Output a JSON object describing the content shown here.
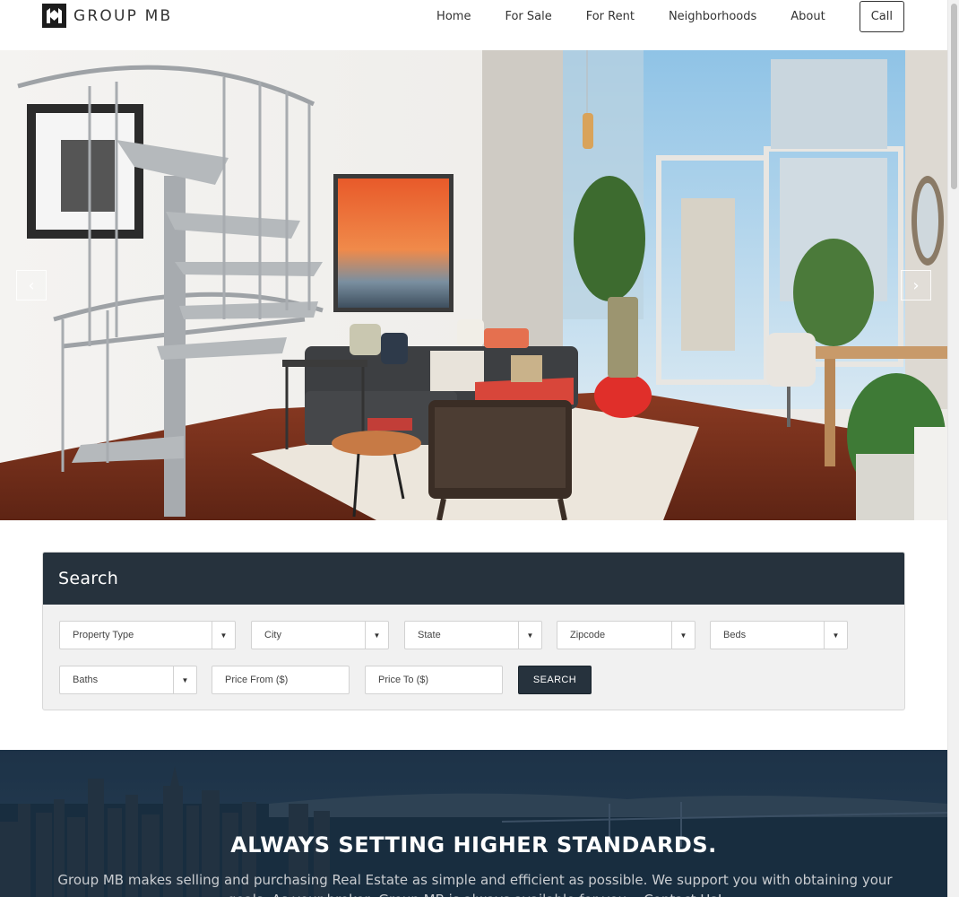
{
  "brand": {
    "name": "GROUP MB"
  },
  "nav": {
    "items": [
      "Home",
      "For Sale",
      "For Rent",
      "Neighborhoods",
      "About"
    ],
    "call_label": "Call"
  },
  "hero": {
    "prev_icon": "chevron-left-icon",
    "next_icon": "chevron-right-icon",
    "prev_glyph": "‹",
    "next_glyph": "›"
  },
  "search": {
    "title": "Search",
    "selects": {
      "property_type": "Property Type",
      "city": "City",
      "state": "State",
      "zipcode": "Zipcode",
      "beds": "Beds",
      "baths": "Baths"
    },
    "price_from_placeholder": "Price From ($)",
    "price_to_placeholder": "Price To ($)",
    "button_label": "SEARCH"
  },
  "banner": {
    "title": "ALWAYS SETTING HIGHER STANDARDS.",
    "text": "Group MB makes selling and purchasing Real Estate as simple and efficient as possible. We support you with obtaining your goals. As your broker, Group MB is always available for you... Contact Us!"
  },
  "colors": {
    "primary": "#26323d",
    "accent": "#e8553a"
  }
}
